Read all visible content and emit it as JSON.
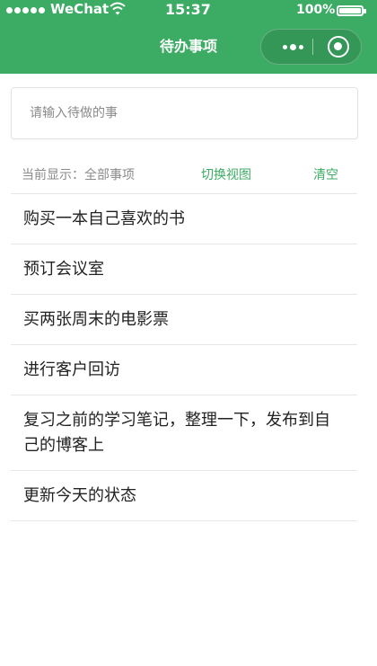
{
  "status_bar": {
    "carrier": "WeChat",
    "time": "15:37",
    "battery": "100%"
  },
  "nav": {
    "title": "待办事项"
  },
  "input": {
    "placeholder": "请输入待做的事",
    "value": ""
  },
  "toolbar": {
    "current_label": "当前显示：全部事项",
    "switch_label": "切换视图",
    "clear_label": "清空"
  },
  "todos": [
    "购买一本自己喜欢的书",
    "预订会议室",
    "买两张周末的电影票",
    "进行客户回访",
    "复习之前的学习笔记，整理一下，发布到自己的博客上",
    "更新今天的状态"
  ],
  "colors": {
    "accent": "#3cab63",
    "muted_text": "#8a8a8a",
    "divider": "#e6e6e6"
  },
  "icons": {
    "signal": "signal-dots-icon",
    "wifi": "wifi-icon",
    "battery": "battery-icon",
    "more": "more-dots-icon",
    "close": "close-circle-icon"
  }
}
